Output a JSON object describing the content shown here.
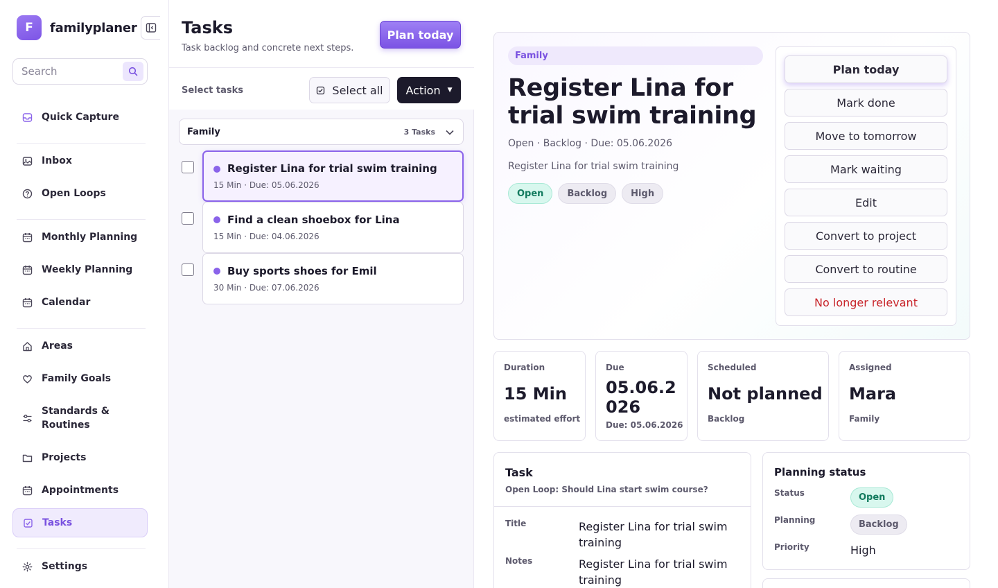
{
  "app": {
    "name": "familyplaner",
    "logo_letter": "F"
  },
  "search": {
    "placeholder": "Search"
  },
  "sidebar": {
    "items": [
      {
        "label": "Quick Capture",
        "icon": "inbox-tray-icon"
      },
      {
        "label": "Inbox",
        "icon": "image-icon"
      },
      {
        "label": "Open Loops",
        "icon": "question-circle-icon"
      },
      {
        "label": "Monthly Planning",
        "icon": "calendar-icon"
      },
      {
        "label": "Weekly Planning",
        "icon": "calendar-icon"
      },
      {
        "label": "Calendar",
        "icon": "calendar-icon"
      },
      {
        "label": "Areas",
        "icon": "home-icon"
      },
      {
        "label": "Family Goals",
        "icon": "heart-icon"
      },
      {
        "label": "Standards & Routines",
        "icon": "sliders-icon"
      },
      {
        "label": "Projects",
        "icon": "folder-icon"
      },
      {
        "label": "Appointments",
        "icon": "calendar-icon"
      },
      {
        "label": "Tasks",
        "icon": "checkbox-icon",
        "active": true
      },
      {
        "label": "Settings",
        "icon": "gear-icon"
      }
    ]
  },
  "tasks_panel": {
    "title": "Tasks",
    "subtitle": "Task backlog and concrete next steps.",
    "plan_today_label": "Plan today",
    "select_label": "Select tasks",
    "select_all_label": "Select all",
    "action_label": "Action",
    "group": {
      "name": "Family",
      "count": "3 Tasks"
    },
    "tasks": [
      {
        "title": "Register Lina for trial swim training",
        "meta": "15 Min · Due: 05.06.2026",
        "selected": true
      },
      {
        "title": "Find a clean shoebox for Lina",
        "meta": "15 Min · Due: 04.06.2026",
        "selected": false
      },
      {
        "title": "Buy sports shoes for Emil",
        "meta": "30 Min · Due: 07.06.2026",
        "selected": false
      }
    ]
  },
  "detail": {
    "area": "Family",
    "title": "Register Lina for trial swim training",
    "meta": "Open · Backlog · Due: 05.06.2026",
    "notes": "Register Lina for trial swim training",
    "badges": [
      "Open",
      "Backlog",
      "High"
    ],
    "actions": {
      "plan_today": "Plan today",
      "mark_done": "Mark done",
      "move_tomorrow": "Move to tomorrow",
      "mark_waiting": "Mark waiting",
      "edit": "Edit",
      "convert_project": "Convert to project",
      "convert_routine": "Convert to routine",
      "no_longer_relevant": "No longer relevant"
    }
  },
  "stats": {
    "duration": {
      "label": "Duration",
      "value": "15 Min",
      "sub": "estimated effort"
    },
    "due": {
      "label": "Due",
      "value": "05.06.2026",
      "sub": "Due: 05.06.2026"
    },
    "scheduled": {
      "label": "Scheduled",
      "value": "Not planned",
      "sub": "Backlog"
    },
    "assigned": {
      "label": "Assigned",
      "value": "Mara",
      "sub": "Family"
    }
  },
  "task_info": {
    "heading": "Task",
    "subheading": "Open Loop: Should Lina start swim course?",
    "title_key": "Title",
    "title_value": "Register Lina for trial swim training",
    "notes_key": "Notes",
    "notes_value": "Register Lina for trial swim training"
  },
  "planning_status": {
    "heading": "Planning status",
    "status_key": "Status",
    "status_value": "Open",
    "planning_key": "Planning",
    "planning_value": "Backlog",
    "priority_key": "Priority",
    "priority_value": "High"
  },
  "colors": {
    "accent": "#8a63ea",
    "accent_dark": "#7b53e4",
    "success_bg": "#d8f7ee",
    "danger": "#c8242a",
    "dark_button": "#1c1a2b"
  }
}
